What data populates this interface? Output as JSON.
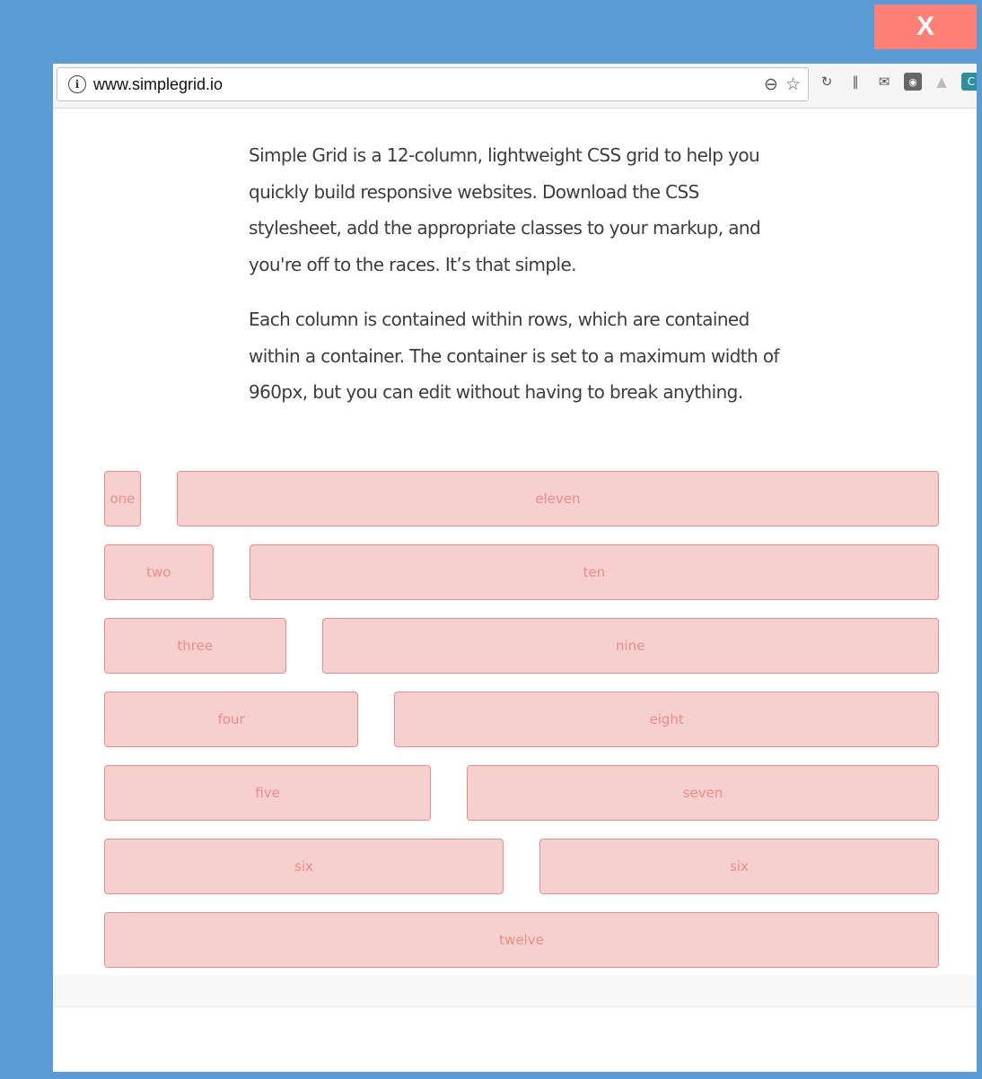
{
  "close_button": {
    "label": "X"
  },
  "browser": {
    "url": "www.simplegrid.io",
    "zoom_icon": "zoom-out-icon",
    "bookmark_icon": "star-icon",
    "extension_icons": [
      "sync-icon",
      "books-icon",
      "mail-icon",
      "lightbulb-icon",
      "drive-icon",
      "extension-icon"
    ]
  },
  "page": {
    "intro_paragraphs": [
      "Simple Grid is a 12-column, lightweight CSS grid to help you quickly build responsive websites. Download the CSS stylesheet, add the appropriate classes to your markup, and you're off to the races. It’s that simple.",
      "Each column is contained within rows, which are contained within a container. The container is set to a maximum width of 960px, but you can edit without having to break anything."
    ],
    "grid_rows": [
      [
        {
          "label": "one",
          "span": 1
        },
        {
          "label": "eleven",
          "span": 11
        }
      ],
      [
        {
          "label": "two",
          "span": 2
        },
        {
          "label": "ten",
          "span": 10
        }
      ],
      [
        {
          "label": "three",
          "span": 3
        },
        {
          "label": "nine",
          "span": 9
        }
      ],
      [
        {
          "label": "four",
          "span": 4
        },
        {
          "label": "eight",
          "span": 8
        }
      ],
      [
        {
          "label": "five",
          "span": 5
        },
        {
          "label": "seven",
          "span": 7
        }
      ],
      [
        {
          "label": "six",
          "span": 6
        },
        {
          "label": "six",
          "span": 6
        }
      ],
      [
        {
          "label": "twelve",
          "span": 12
        }
      ]
    ]
  },
  "colors": {
    "frame": "#5b9bd5",
    "close_button": "#fd7f75",
    "cell_fill": "#f5d0cf",
    "cell_border": "#f28a85"
  }
}
